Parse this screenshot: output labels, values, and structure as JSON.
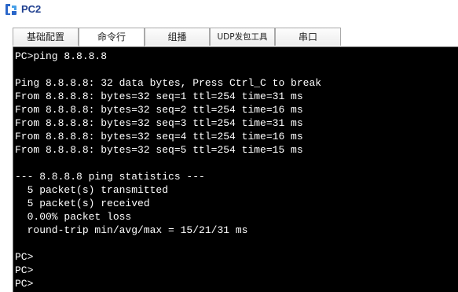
{
  "window": {
    "title": "PC2",
    "icon": "pc-icon"
  },
  "tabs": [
    {
      "label": "基础配置",
      "active": false
    },
    {
      "label": "命令行",
      "active": true
    },
    {
      "label": "组播",
      "active": false
    },
    {
      "label": "UDP发包工具",
      "active": false
    },
    {
      "label": "串口",
      "active": false
    }
  ],
  "terminal": {
    "lines": [
      "PC>ping 8.8.8.8",
      "",
      "Ping 8.8.8.8: 32 data bytes, Press Ctrl_C to break",
      "From 8.8.8.8: bytes=32 seq=1 ttl=254 time=31 ms",
      "From 8.8.8.8: bytes=32 seq=2 ttl=254 time=16 ms",
      "From 8.8.8.8: bytes=32 seq=3 ttl=254 time=31 ms",
      "From 8.8.8.8: bytes=32 seq=4 ttl=254 time=16 ms",
      "From 8.8.8.8: bytes=32 seq=5 ttl=254 time=15 ms",
      "",
      "--- 8.8.8.8 ping statistics ---",
      "  5 packet(s) transmitted",
      "  5 packet(s) received",
      "  0.00% packet loss",
      "  round-trip min/avg/max = 15/21/31 ms",
      "",
      "PC>",
      "PC>",
      "PC>"
    ]
  },
  "colors": {
    "terminal_bg": "#000000",
    "terminal_fg": "#ffffff",
    "title": "#1f3f8f"
  }
}
